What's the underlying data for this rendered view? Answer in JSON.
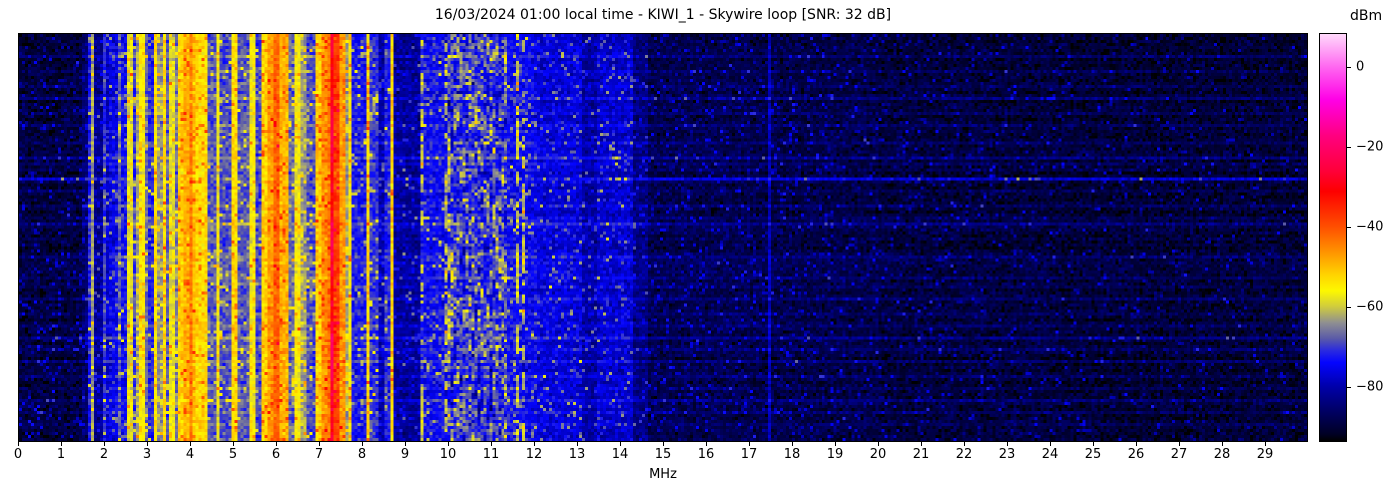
{
  "chart_data": {
    "type": "heatmap",
    "title": "16/03/2024 01:00 local time - KIWI_1 - Skywire loop [SNR: 32 dB]",
    "xlabel": "MHz",
    "x_range": [
      0,
      30
    ],
    "x_ticks": [
      0,
      1,
      2,
      3,
      4,
      5,
      6,
      7,
      8,
      9,
      10,
      11,
      12,
      13,
      14,
      15,
      16,
      17,
      18,
      19,
      20,
      21,
      22,
      23,
      24,
      25,
      26,
      27,
      28,
      29
    ],
    "y_axis": {
      "description": "time (waterfall rows, no tick labels shown)"
    },
    "colorbar": {
      "label": "dBm",
      "vmax": 8.5,
      "vmin": -93.7,
      "ticks": [
        {
          "value": 0,
          "label": "0"
        },
        {
          "value": -20,
          "label": "−20"
        },
        {
          "value": -40,
          "label": "−40"
        },
        {
          "value": -60,
          "label": "−60"
        },
        {
          "value": -80,
          "label": "−80"
        }
      ],
      "colormap": [
        [
          -93.7,
          "#000000"
        ],
        [
          -92,
          "#000024"
        ],
        [
          -86,
          "#000066"
        ],
        [
          -80,
          "#0000aa"
        ],
        [
          -74,
          "#0404ff"
        ],
        [
          -71,
          "#2a2ae0"
        ],
        [
          -68,
          "#5a5aa8"
        ],
        [
          -64,
          "#8f8f91"
        ],
        [
          -60,
          "#cfcb3e"
        ],
        [
          -56,
          "#fdf800"
        ],
        [
          -52,
          "#ffd400"
        ],
        [
          -46,
          "#ff9100"
        ],
        [
          -40,
          "#ff5000"
        ],
        [
          -31,
          "#fd0000"
        ],
        [
          -26,
          "#ff0038"
        ],
        [
          -17,
          "#ff0080"
        ],
        [
          -8,
          "#ff00e6"
        ],
        [
          0,
          "#ff64f0"
        ],
        [
          8.5,
          "#ffd9fb"
        ]
      ]
    },
    "spectrum_bands": [
      [
        0,
        1.45,
        -90
      ],
      [
        1.45,
        1.5,
        -78
      ],
      [
        1.5,
        1.58,
        -86
      ],
      [
        1.58,
        1.64,
        -73
      ],
      [
        1.64,
        1.7,
        -81
      ],
      [
        1.7,
        1.74,
        -63
      ],
      [
        1.74,
        1.95,
        -83
      ],
      [
        1.95,
        2.0,
        -71
      ],
      [
        2.0,
        2.07,
        -78
      ],
      [
        2.07,
        2.12,
        -70
      ],
      [
        2.12,
        2.3,
        -76
      ],
      [
        2.3,
        2.36,
        -68
      ],
      [
        2.36,
        2.5,
        -74
      ],
      [
        2.5,
        2.62,
        -58
      ],
      [
        2.62,
        2.72,
        -71
      ],
      [
        2.72,
        2.8,
        -62
      ],
      [
        2.8,
        2.9,
        -55
      ],
      [
        2.9,
        3.0,
        -67
      ],
      [
        3.0,
        3.16,
        -72
      ],
      [
        3.16,
        3.23,
        -53
      ],
      [
        3.23,
        3.32,
        -64
      ],
      [
        3.32,
        3.4,
        -53
      ],
      [
        3.4,
        3.52,
        -68
      ],
      [
        3.52,
        3.62,
        -58
      ],
      [
        3.62,
        3.72,
        -66
      ],
      [
        3.72,
        3.82,
        -52
      ],
      [
        3.82,
        3.95,
        -49
      ],
      [
        3.95,
        4.02,
        -44
      ],
      [
        4.02,
        4.1,
        -50
      ],
      [
        4.1,
        4.42,
        -53
      ],
      [
        4.42,
        4.6,
        -68
      ],
      [
        4.6,
        4.68,
        -57
      ],
      [
        4.68,
        4.92,
        -69
      ],
      [
        4.92,
        5.1,
        -53
      ],
      [
        5.1,
        5.2,
        -68
      ],
      [
        5.2,
        5.26,
        -60,
        "i"
      ],
      [
        5.26,
        5.36,
        -68
      ],
      [
        5.36,
        5.5,
        -56
      ],
      [
        5.5,
        5.68,
        -70
      ],
      [
        5.68,
        5.82,
        -52
      ],
      [
        5.82,
        5.95,
        -47
      ],
      [
        5.95,
        6.06,
        -42
      ],
      [
        6.06,
        6.25,
        -49
      ],
      [
        6.25,
        6.45,
        -67
      ],
      [
        6.45,
        6.58,
        -56
      ],
      [
        6.58,
        6.72,
        -63
      ],
      [
        6.72,
        6.88,
        -69
      ],
      [
        6.88,
        7.05,
        -52
      ],
      [
        7.05,
        7.16,
        -46
      ],
      [
        7.16,
        7.26,
        -43
      ],
      [
        7.26,
        7.35,
        -26,
        "s"
      ],
      [
        7.35,
        7.44,
        -38
      ],
      [
        7.44,
        7.5,
        -33,
        "s"
      ],
      [
        7.5,
        7.62,
        -47
      ],
      [
        7.62,
        7.7,
        -63
      ],
      [
        7.7,
        7.76,
        -55
      ],
      [
        7.76,
        8.08,
        -73
      ],
      [
        8.08,
        8.16,
        -53
      ],
      [
        8.16,
        8.34,
        -71
      ],
      [
        8.34,
        8.52,
        -80
      ],
      [
        8.52,
        8.64,
        -73
      ],
      [
        8.64,
        8.71,
        -53
      ],
      [
        8.71,
        9.34,
        -82
      ],
      [
        9.34,
        9.42,
        -60,
        "i"
      ],
      [
        9.42,
        9.88,
        -74
      ],
      [
        9.88,
        9.96,
        -62,
        "i"
      ],
      [
        9.96,
        11.4,
        -71,
        "z"
      ],
      [
        11.4,
        11.56,
        -74
      ],
      [
        11.56,
        11.64,
        -61,
        "i"
      ],
      [
        11.64,
        11.72,
        -74
      ],
      [
        11.72,
        11.8,
        -62,
        "i"
      ],
      [
        11.8,
        12.1,
        -75
      ],
      [
        12.1,
        13.1,
        -77
      ],
      [
        13.1,
        13.5,
        -81
      ],
      [
        13.5,
        14.3,
        -78
      ],
      [
        14.3,
        14.65,
        -84
      ],
      [
        14.65,
        17.0,
        -88.5
      ],
      [
        17.0,
        20.0,
        -89
      ],
      [
        20.0,
        24.0,
        -90
      ],
      [
        24.0,
        30.0,
        -90.5
      ]
    ],
    "carriers": [
      {
        "mhz": 17.42,
        "dbm": -79
      }
    ],
    "main_time_streak": {
      "row_frac": 0.355,
      "boost_db": 14
    },
    "time_streaks": [
      [
        0.055,
        4
      ],
      [
        0.09,
        3
      ],
      [
        0.125,
        3
      ],
      [
        0.155,
        5
      ],
      [
        0.19,
        3
      ],
      [
        0.225,
        4
      ],
      [
        0.27,
        4
      ],
      [
        0.3,
        6
      ],
      [
        0.318,
        4
      ],
      [
        0.335,
        3
      ],
      [
        0.385,
        3
      ],
      [
        0.42,
        4
      ],
      [
        0.455,
        3
      ],
      [
        0.47,
        5
      ],
      [
        0.505,
        3
      ],
      [
        0.545,
        4
      ],
      [
        0.565,
        3
      ],
      [
        0.6,
        4
      ],
      [
        0.625,
        3
      ],
      [
        0.655,
        5
      ],
      [
        0.69,
        3
      ],
      [
        0.715,
        4
      ],
      [
        0.745,
        6
      ],
      [
        0.78,
        3
      ],
      [
        0.81,
        4
      ],
      [
        0.845,
        4
      ],
      [
        0.875,
        3
      ],
      [
        0.905,
        5
      ],
      [
        0.935,
        4
      ],
      [
        0.965,
        3
      ]
    ],
    "diagonal_chirp": {
      "f_start": 8.05,
      "row_frac_start": 0.235,
      "f_end": 8.42,
      "row_frac_end": 0.112,
      "boost_db": 9
    },
    "noise": {
      "sigma_db": 2.2,
      "speckle_prob": 0.09,
      "speckle_max_db": 10,
      "seed": 42
    }
  }
}
